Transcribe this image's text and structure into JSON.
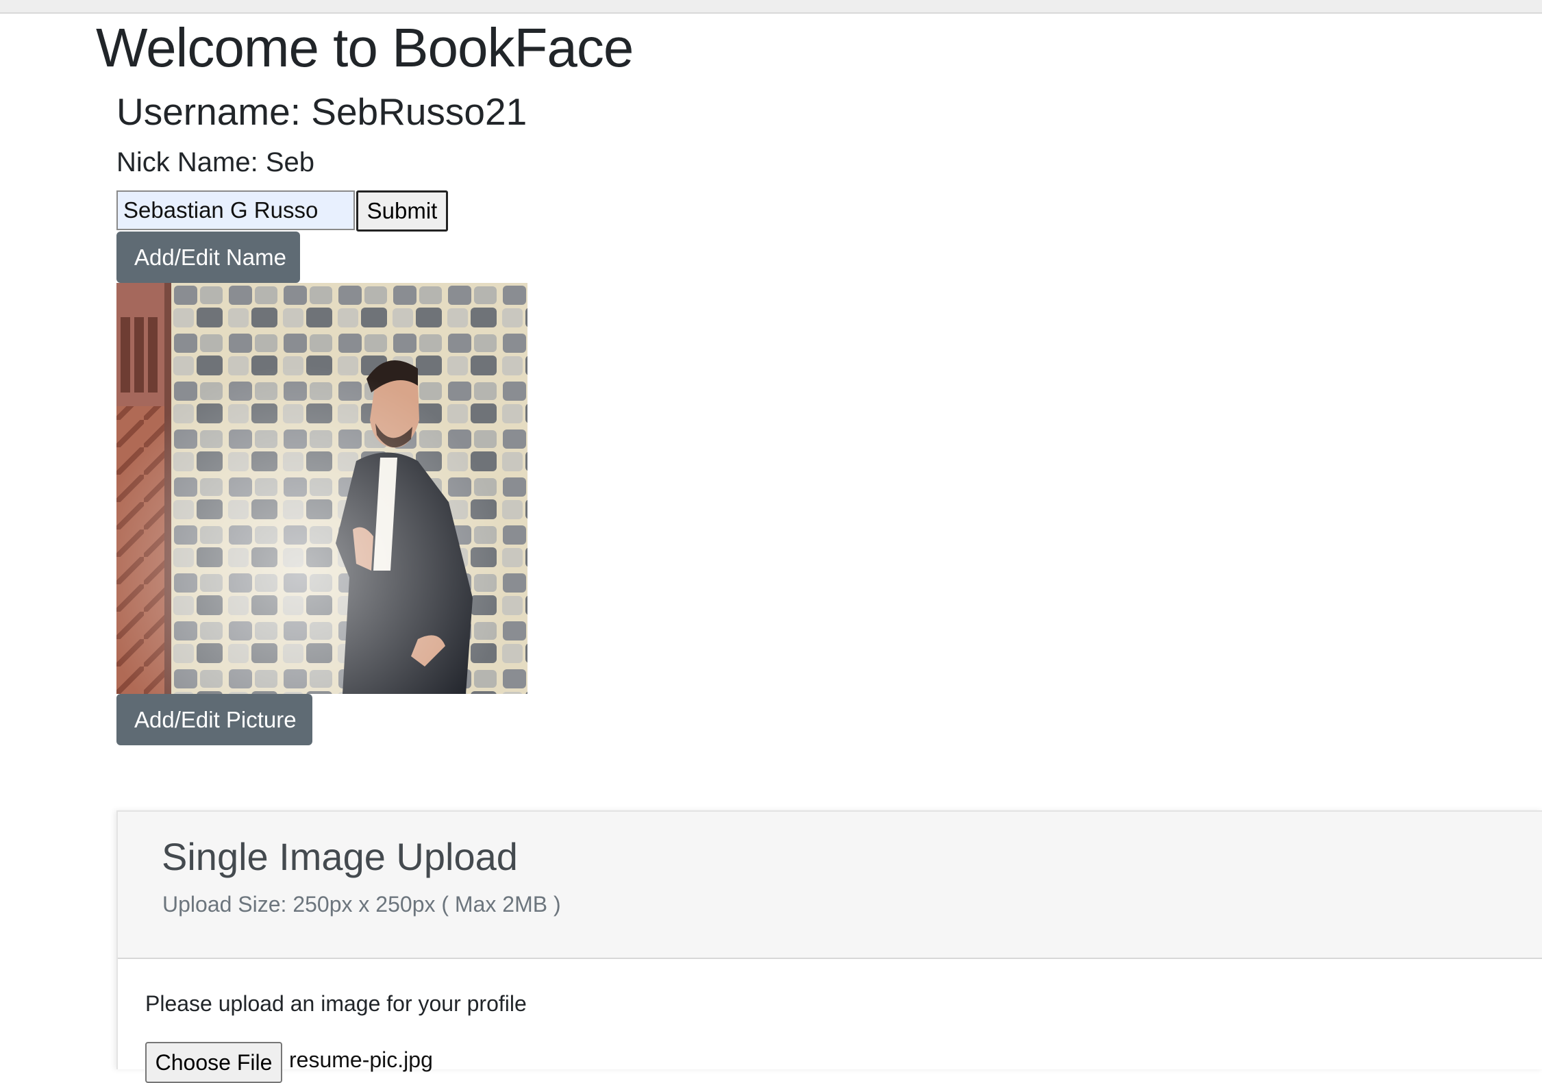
{
  "page": {
    "title": "Welcome to BookFace"
  },
  "profile": {
    "username_text": "Username: SebRusso21",
    "nickname_text": "Nick Name: Seb",
    "name_input_value": "Sebastian G Russo",
    "submit_label": "Submit",
    "edit_name_label": "Add/Edit Name",
    "edit_picture_label": "Add/Edit Picture",
    "photo_alt": "Profile picture"
  },
  "upload": {
    "title": "Single Image Upload",
    "subtitle": "Upload Size: 250px x 250px ( Max 2MB )",
    "prompt": "Please upload an image for your profile",
    "choose_file_label": "Choose File",
    "selected_file": "resume-pic.jpg"
  },
  "colors": {
    "secondary_button": "#5f6b74",
    "input_autofill_bg": "#e8f0fe",
    "card_header_bg": "#f6f6f6"
  }
}
